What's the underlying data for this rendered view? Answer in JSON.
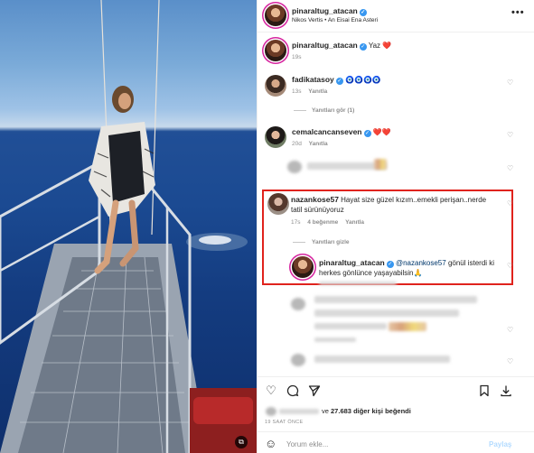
{
  "post": {
    "author": "pinaraltug_atacan",
    "audio": "Nikos Vertis • An Eisai Ena Asteri",
    "caption_text": "Yaz",
    "caption_emoji": "❤️",
    "caption_age": "19s"
  },
  "comments": [
    {
      "user": "fadikatasoy",
      "text": "🧿🧿🧿🧿",
      "age": "13s",
      "reply_label": "Yanıtla",
      "view_replies": "Yanıtları gör (1)"
    },
    {
      "user": "cemalcancanseven",
      "text": "❤️❤️",
      "age": "20d",
      "reply_label": "Yanıtla"
    },
    {
      "user": "nazankose57",
      "text": "Hayat size güzel kızım..emekli perişan..nerde tatil sürünüyoruz",
      "age": "17s",
      "likes": "4 beğenme",
      "reply_label": "Yanıtla",
      "hide_replies": "Yanıtları gizle"
    },
    {
      "user": "pinaraltug_atacan",
      "mention": "@nazankose57",
      "text": "gönül isterdi ki herkes gönlünce yaşayabilsin🙏"
    }
  ],
  "actions": {
    "likes_count": "27.683",
    "likes_suffix": "diğer kişi beğendi",
    "likes_prefix_connector": "ve",
    "time_ago": "19 SAAT ÖNCE",
    "comment_placeholder": "Yorum ekle...",
    "post_button": "Paylaş"
  },
  "icons": [
    "more-icon",
    "heart-icon",
    "comment-icon",
    "share-icon",
    "bookmark-icon",
    "download-icon",
    "emoji-icon",
    "verified-icon",
    "multi-media-icon"
  ],
  "colors": {
    "verified": "#3897f0",
    "highlight": "#e0231d",
    "link": "#00376b"
  }
}
